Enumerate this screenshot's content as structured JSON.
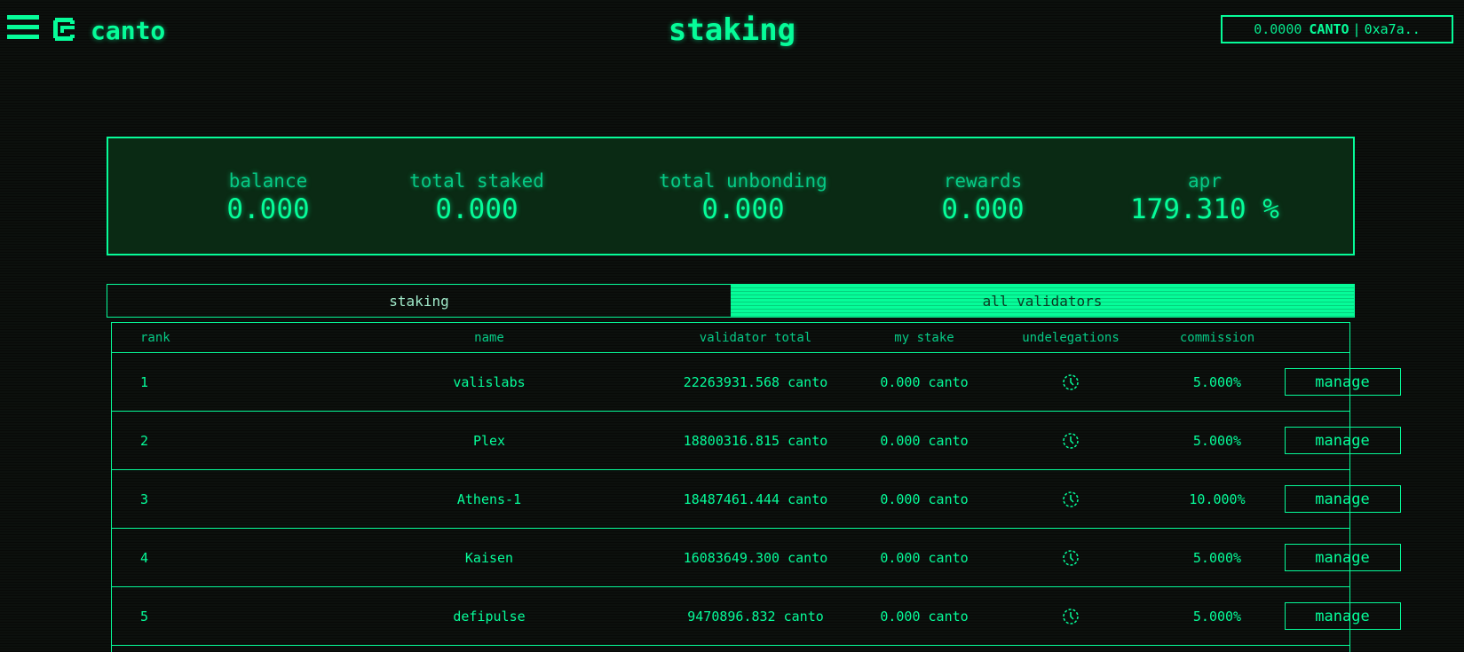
{
  "header": {
    "logo_text": "canto",
    "title": "staking",
    "wallet": {
      "balance": "0.0000",
      "token": "CANTO",
      "separator": "|",
      "address": "0xa7a.."
    }
  },
  "stats": [
    {
      "label": "balance",
      "value": "0.000"
    },
    {
      "label": "total staked",
      "value": "0.000"
    },
    {
      "label": "total unbonding",
      "value": "0.000"
    },
    {
      "label": "rewards",
      "value": "0.000"
    },
    {
      "label": "apr",
      "value": "179.310 %"
    }
  ],
  "tabs": [
    {
      "label": "staking",
      "active": false
    },
    {
      "label": "all validators",
      "active": true
    }
  ],
  "table": {
    "headers": {
      "rank": "rank",
      "name": "name",
      "validator_total": "validator total",
      "my_stake": "my stake",
      "undelegations": "undelegations",
      "commission": "commission"
    },
    "rows": [
      {
        "rank": "1",
        "name": "valislabs",
        "validator_total": "22263931.568 canto",
        "my_stake": "0.000 canto",
        "undelegations_icon": "clock-icon",
        "commission": "5.000%",
        "action": "manage"
      },
      {
        "rank": "2",
        "name": "Plex",
        "validator_total": "18800316.815 canto",
        "my_stake": "0.000 canto",
        "undelegations_icon": "clock-icon",
        "commission": "5.000%",
        "action": "manage"
      },
      {
        "rank": "3",
        "name": "Athens-1",
        "validator_total": "18487461.444 canto",
        "my_stake": "0.000 canto",
        "undelegations_icon": "clock-icon",
        "commission": "10.000%",
        "action": "manage"
      },
      {
        "rank": "4",
        "name": "Kaisen",
        "validator_total": "16083649.300 canto",
        "my_stake": "0.000 canto",
        "undelegations_icon": "clock-icon",
        "commission": "5.000%",
        "action": "manage"
      },
      {
        "rank": "5",
        "name": "defipulse",
        "validator_total": "9470896.832 canto",
        "my_stake": "0.000 canto",
        "undelegations_icon": "clock-icon",
        "commission": "5.000%",
        "action": "manage"
      }
    ]
  },
  "colors": {
    "accent": "#06fc99",
    "background": "#0c100d",
    "panel": "#0a2a14"
  }
}
